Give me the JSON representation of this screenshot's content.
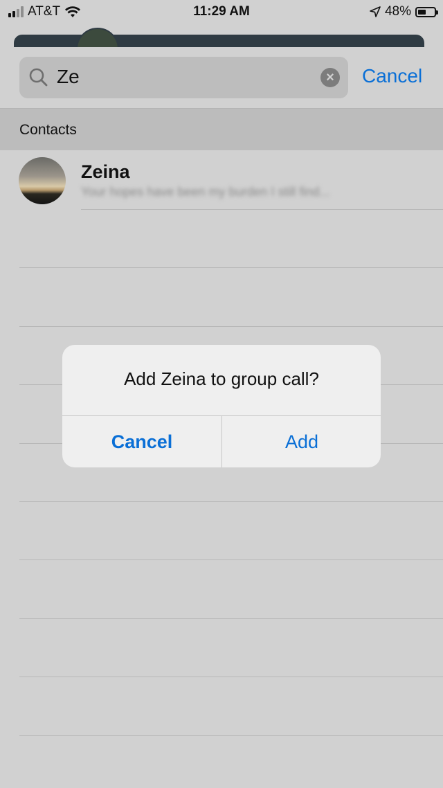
{
  "status_bar": {
    "carrier": "AT&T",
    "time": "11:29 AM",
    "battery": "48%",
    "battery_level": 0.48,
    "icons": [
      "signal-icon",
      "wifi-icon",
      "location-arrow-icon",
      "battery-icon"
    ]
  },
  "search": {
    "query": "Ze",
    "cancel_label": "Cancel",
    "icons": [
      "search-icon",
      "clear-icon"
    ]
  },
  "section": {
    "title": "Contacts"
  },
  "contacts": [
    {
      "name": "Zeina",
      "preview": "Your hopes have been my burden I still find..."
    }
  ],
  "alert": {
    "title": "Add Zeina to group call?",
    "cancel_label": "Cancel",
    "add_label": "Add"
  },
  "colors": {
    "accent": "#0a6fd6",
    "background": "#d1d1d1",
    "section_header": "#bcbcbc",
    "alert_background": "#efefef"
  }
}
